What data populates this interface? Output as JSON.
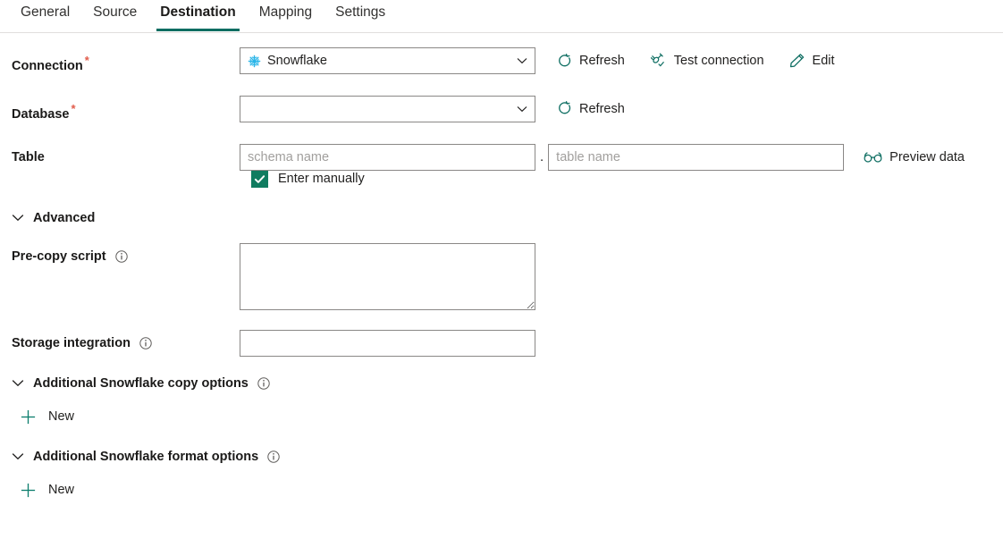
{
  "tabs": [
    {
      "label": "General",
      "selected": false
    },
    {
      "label": "Source",
      "selected": false
    },
    {
      "label": "Destination",
      "selected": true
    },
    {
      "label": "Mapping",
      "selected": false
    },
    {
      "label": "Settings",
      "selected": false
    }
  ],
  "connection": {
    "label": "Connection",
    "required": "*",
    "value": "Snowflake",
    "icon": "snowflake-icon",
    "refresh_label": "Refresh",
    "test_connection_label": "Test connection",
    "edit_label": "Edit"
  },
  "database": {
    "label": "Database",
    "required": "*",
    "value": "",
    "refresh_label": "Refresh"
  },
  "table": {
    "label": "Table",
    "schema_placeholder": "schema name",
    "schema_value": "",
    "separator": ".",
    "table_placeholder": "table name",
    "table_value": "",
    "preview_label": "Preview data",
    "enter_manually_label": "Enter manually",
    "enter_manually_checked": true
  },
  "advanced": {
    "label": "Advanced",
    "expanded": true
  },
  "precopy": {
    "label": "Pre-copy script",
    "value": "",
    "placeholder": ""
  },
  "storage_integration": {
    "label": "Storage integration",
    "value": "",
    "placeholder": ""
  },
  "copy_options": {
    "label": "Additional Snowflake copy options",
    "new_label": "New"
  },
  "format_options": {
    "label": "Additional Snowflake format options",
    "new_label": "New"
  },
  "colors": {
    "accent_teal": "#0e6e62",
    "checkbox_green": "#107c60",
    "snowflake_blue": "#29b5e8",
    "required_red": "#e15c4b",
    "border_gray": "#8a8886"
  }
}
